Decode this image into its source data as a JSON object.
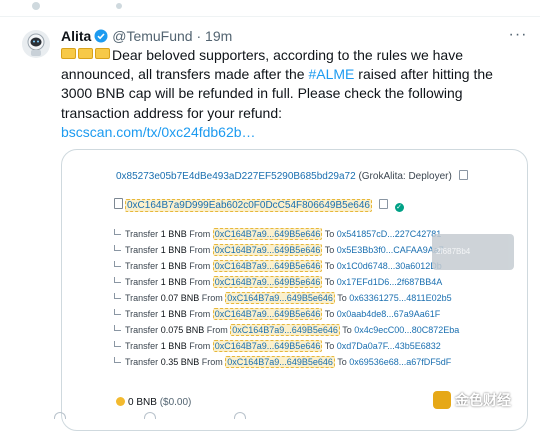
{
  "tweet": {
    "author_name": "Alita",
    "handle": "@TemuFund",
    "separator": "·",
    "time": "19m",
    "more_glyph": "···",
    "text_part1": "Dear beloved supporters, according to the rules we have announced, all transfers made after the ",
    "hashtag": "#ALME",
    "text_part2": " raised after hitting the 3000 BNB cap will be refunded in full. Please check the following transaction address for your refund:",
    "link": "bscscan.com/tx/0xc24fdb62b…"
  },
  "card": {
    "deployer_address": "0x85273e05b7E4dBe493aD227EF5290B685bd29a72",
    "deployer_label": "(GrokAlita: Deployer)",
    "contract_address": "0xC164B7a9D999Eab602c0F0DcC54F806649B5e646",
    "tooltip_text": "2f687Bb4",
    "transfers": [
      {
        "label": "Transfer",
        "amount": "1 BNB",
        "from_word": "From",
        "from": "0xC164B7a9...649B5e646",
        "to_word": "To",
        "to": "0x541857cD...227C42781"
      },
      {
        "label": "Transfer",
        "amount": "1 BNB",
        "from_word": "From",
        "from": "0xC164B7a9...649B5e646",
        "to_word": "To",
        "to": "0x5E3Bb3f0...CAFAA9Aa7"
      },
      {
        "label": "Transfer",
        "amount": "1 BNB",
        "from_word": "From",
        "from": "0xC164B7a9...649B5e646",
        "to_word": "To",
        "to": "0x1C0d6748...30a6012Db"
      },
      {
        "label": "Transfer",
        "amount": "1 BNB",
        "from_word": "From",
        "from": "0xC164B7a9...649B5e646",
        "to_word": "To",
        "to": "0x17EFd1D6...2f687BB4A"
      },
      {
        "label": "Transfer",
        "amount": "0.07 BNB",
        "from_word": "From",
        "from": "0xC164B7a9...649B5e646",
        "to_word": "To",
        "to": "0x63361275...4811E02b5"
      },
      {
        "label": "Transfer",
        "amount": "1 BNB",
        "from_word": "From",
        "from": "0xC164B7a9...649B5e646",
        "to_word": "To",
        "to": "0x0aab4de8...67a9Aa61F"
      },
      {
        "label": "Transfer",
        "amount": "0.075 BNB",
        "from_word": "From",
        "from": "0xC164B7a9...649B5e646",
        "to_word": "To",
        "to": "0x4c9ecC00...80C872Eba"
      },
      {
        "label": "Transfer",
        "amount": "1 BNB",
        "from_word": "From",
        "from": "0xC164B7a9...649B5e646",
        "to_word": "To",
        "to": "0xd7Da0a7F...43b5E6832"
      },
      {
        "label": "Transfer",
        "amount": "0.35 BNB",
        "from_word": "From",
        "from": "0xC164B7a9...649B5e646",
        "to_word": "To",
        "to": "0x69536e68...a67fDF5dF"
      }
    ],
    "balance_bnb": "0 BNB",
    "balance_usd": "($0.00)"
  },
  "watermark": {
    "text": "金色财经"
  },
  "colors": {
    "link": "#1d9bf0",
    "text": "#0f1419",
    "muted": "#536471",
    "highlight": "#fbf0cc",
    "verified": "#1d9bf0"
  },
  "icons": [
    "avatar",
    "verified-badge-icon",
    "more-icon",
    "emoji-icon",
    "copy-icon",
    "check-icon",
    "document-icon",
    "bnb-coin-icon"
  ]
}
